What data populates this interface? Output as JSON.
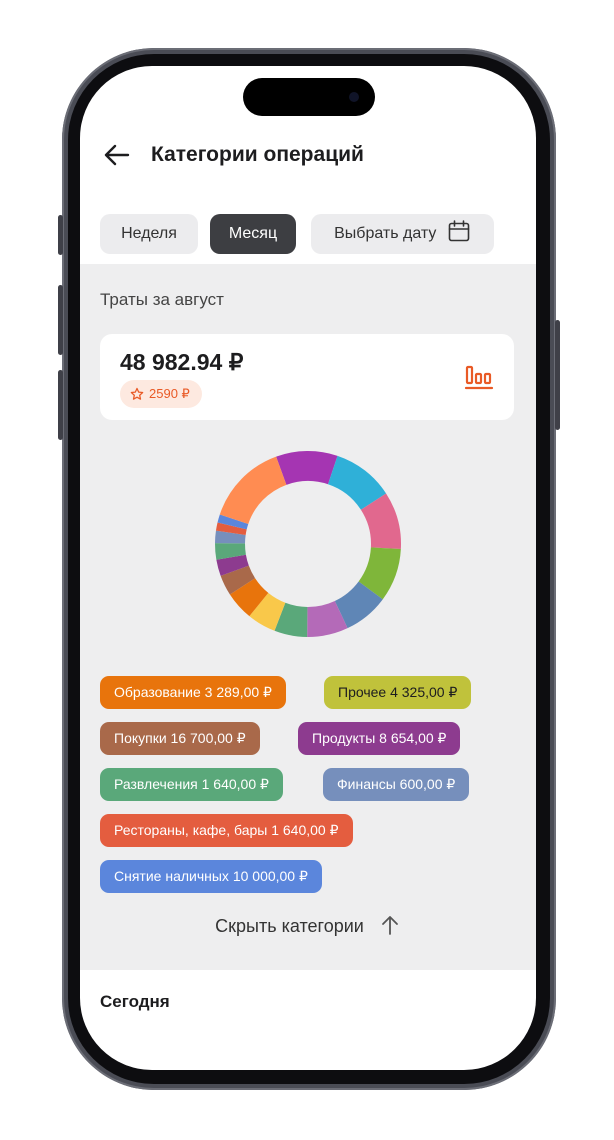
{
  "header": {
    "title": "Категории операций"
  },
  "periods": [
    {
      "label": "Неделя",
      "active": false
    },
    {
      "label": "Месяц",
      "active": true
    },
    {
      "label": "Выбрать дату",
      "active": false
    }
  ],
  "summary": {
    "label": "Траты за август",
    "total": "48 982.94 ₽",
    "cashback": "2590 ₽"
  },
  "colors": {
    "accent": "#e95a26",
    "chip_active": "#3d3e42",
    "background_panel": "#eeeeef"
  },
  "categories": [
    {
      "label": "Образование 3 289,00 ₽",
      "color": "#e8740c"
    },
    {
      "label": "Прочее 4 325,00 ₽",
      "color": "#c0c23b"
    },
    {
      "label": "Покупки 16 700,00 ₽",
      "color": "#a9694a"
    },
    {
      "label": "Продукты 8 654,00 ₽",
      "color": "#8d3b8f"
    },
    {
      "label": "Развлечения 1 640,00 ₽",
      "color": "#5aa87a"
    },
    {
      "label": "Финансы 600,00 ₽",
      "color": "#768fbc"
    },
    {
      "label": "Рестораны, кафе, бары 1 640,00 ₽",
      "color": "#e45d3f"
    },
    {
      "label": "Снятие наличных 10 000,00 ₽",
      "color": "#5b86dc"
    }
  ],
  "hide_categories": "Скрыть категории",
  "today": "Сегодня",
  "icons": {
    "back": "arrow-left-icon",
    "calendar": "calendar-icon",
    "cashback": "star-outline-icon",
    "chart": "bar-chart-icon",
    "hide": "arrow-up-icon"
  }
}
